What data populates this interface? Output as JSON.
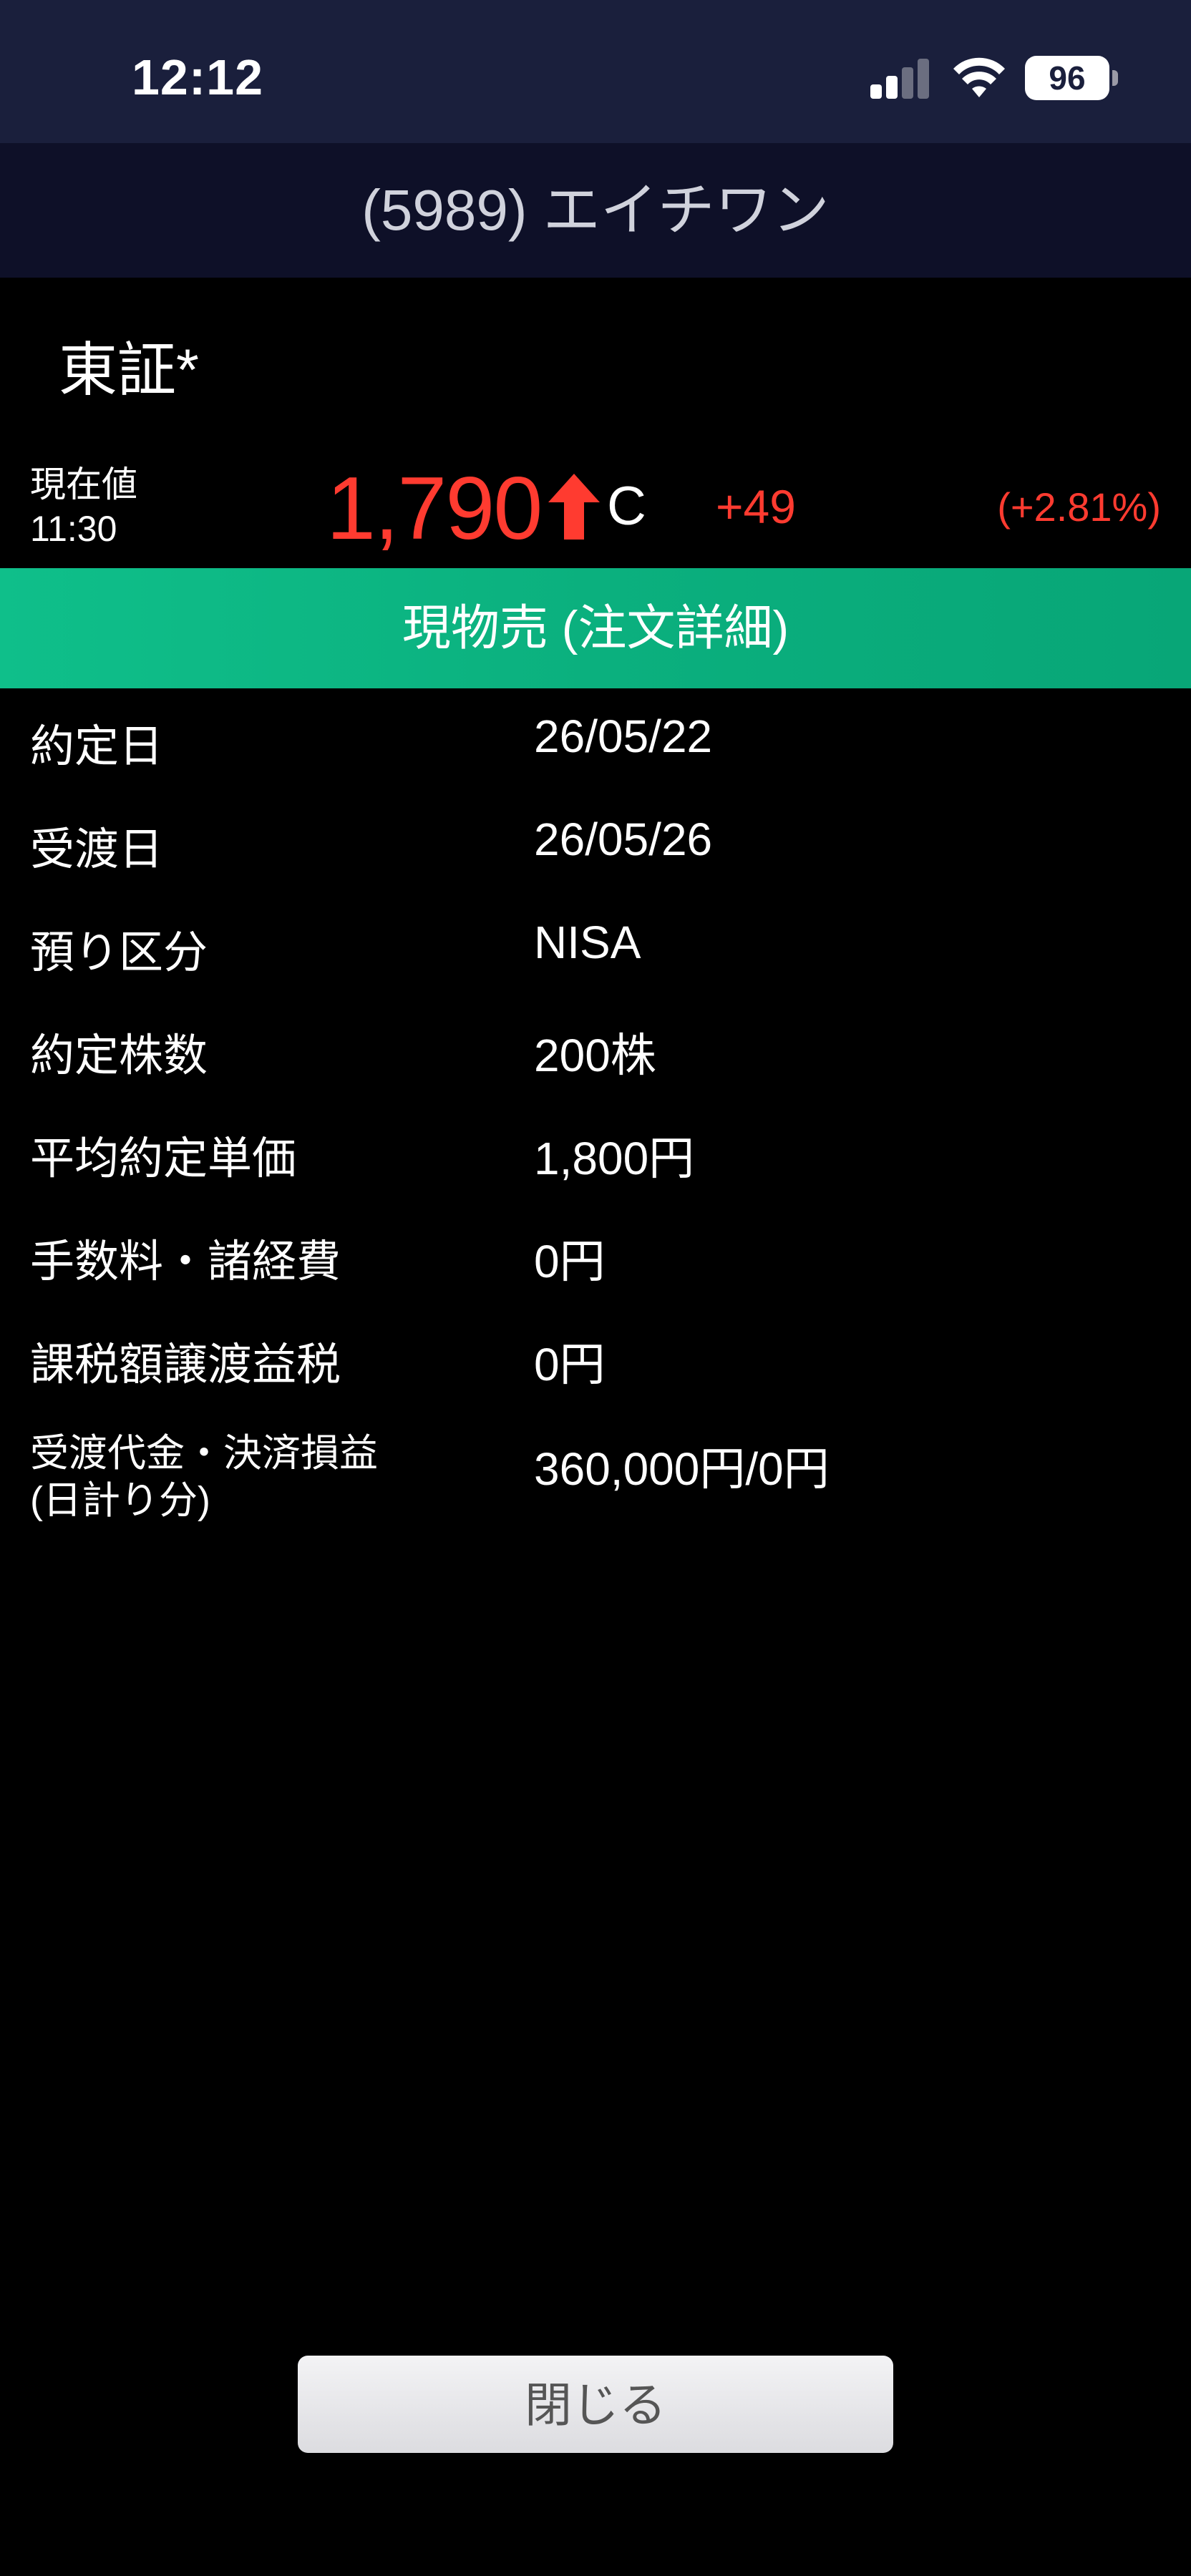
{
  "status_bar": {
    "time": "12:12",
    "battery": "96",
    "signal_icon": "cellular-signal-icon",
    "wifi_icon": "wifi-icon"
  },
  "header": {
    "title": "(5989) エイチワン"
  },
  "market": "東証*",
  "quote": {
    "label": "現在値",
    "time": "11:30",
    "price": "1,790",
    "direction_icon": "up-arrow-icon",
    "flag": "C",
    "change": "+49",
    "change_pct": "(+2.81%)",
    "up_color": "#ff3b30"
  },
  "order": {
    "title": "現物売 (注文詳細)",
    "header_color": "#0fbf8a",
    "rows": [
      {
        "label": "約定日",
        "value": "26/05/22"
      },
      {
        "label": "受渡日",
        "value": "26/05/26"
      },
      {
        "label": "預り区分",
        "value": "NISA"
      },
      {
        "label": "約定株数",
        "value": "200株"
      },
      {
        "label": "平均約定単価",
        "value": "1,800円"
      },
      {
        "label": "手数料・諸経費",
        "value": "0円"
      },
      {
        "label": "課税額譲渡益税",
        "value": "0円"
      },
      {
        "label": "受渡代金・決済損益\n(日計り分)",
        "value": "360,000円/0円"
      }
    ]
  },
  "buttons": {
    "close_label": "閉じる"
  }
}
